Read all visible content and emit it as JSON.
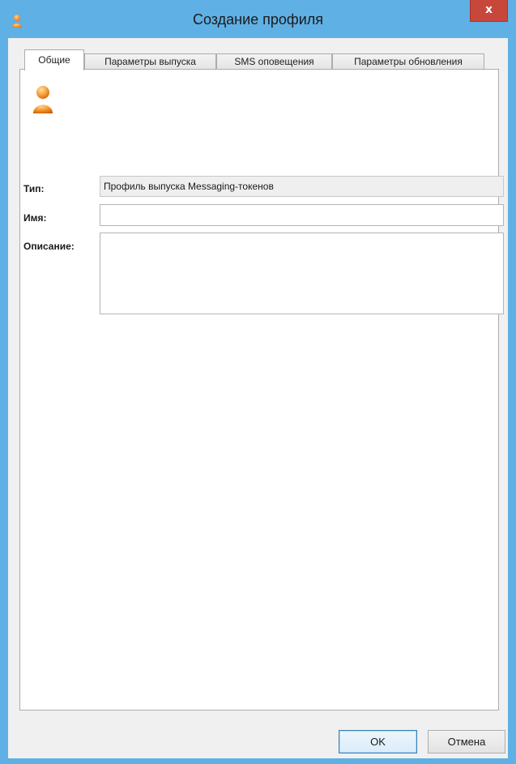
{
  "window": {
    "title": "Создание профиля",
    "close_glyph": "x",
    "icon": "user-profile-icon"
  },
  "tabs": [
    {
      "label": "Общие",
      "active": true
    },
    {
      "label": "Параметры выпуска",
      "active": false
    },
    {
      "label": "SMS оповещения",
      "active": false
    },
    {
      "label": "Параметры обновления",
      "active": false
    }
  ],
  "general": {
    "profile_icon": "user-profile-icon",
    "type_label": "Тип:",
    "type_value": "Профиль выпуска Messaging-токенов",
    "name_label": "Имя:",
    "name_value": "",
    "description_label": "Описание:",
    "description_value": ""
  },
  "buttons": {
    "ok_label": "OK",
    "cancel_label": "Отмена"
  },
  "colors": {
    "titlebar": "#5fb0e4",
    "close_button": "#c7473b",
    "icon_orange": "#f08a1c"
  }
}
